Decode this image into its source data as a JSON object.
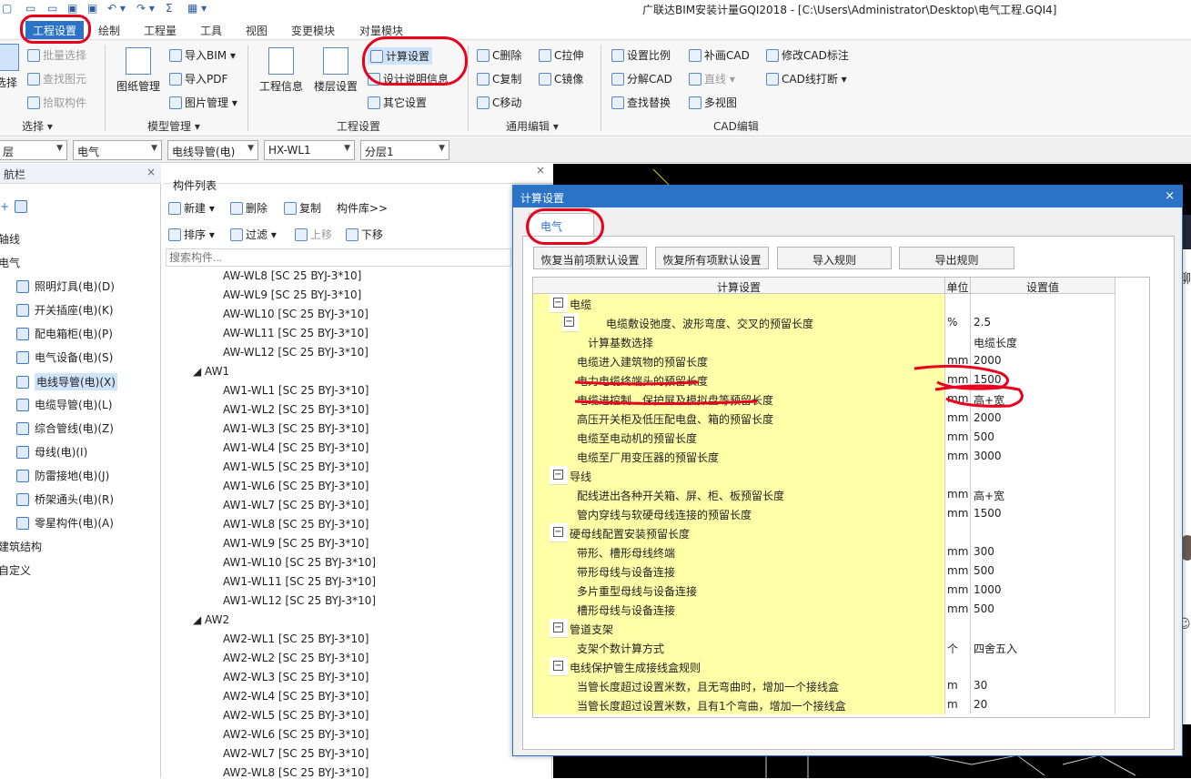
{
  "window": {
    "title": "广联达BIM安装计量GQI2018 - [C:\\Users\\Administrator\\Desktop\\电气工程.GQI4]"
  },
  "menu": {
    "tabs": [
      "工程设置",
      "绘制",
      "工程量",
      "工具",
      "视图",
      "变更模块",
      "对量模块"
    ]
  },
  "ribbon": {
    "select_group": {
      "big_label": "选择",
      "items": [
        "批量选择",
        "查找图元",
        "拾取构件"
      ],
      "label": "选择 ▾"
    },
    "model_group": {
      "big_label": "图纸管理",
      "items": [
        "导入BIM ▾",
        "导入PDF",
        "图片管理 ▾"
      ],
      "label": "模型管理 ▾"
    },
    "project_group": {
      "big1": "工程信息",
      "big2": "楼层设置",
      "items": [
        "计算设置",
        "设计说明信息",
        "其它设置"
      ],
      "label": "工程设置"
    },
    "edit_group": {
      "items": [
        "C删除",
        "C拉伸",
        "C复制",
        "C镜像",
        "C移动"
      ],
      "label": "通用编辑 ▾"
    },
    "cad_group": {
      "items": [
        "设置比例",
        "补画CAD",
        "修改CAD标注",
        "分解CAD",
        "直线 ▾",
        "CAD线打断 ▾",
        "查找替换",
        "多视图"
      ],
      "label": "CAD编辑"
    }
  },
  "filters": {
    "floor": "层",
    "discipline": "电气",
    "type": "电线导管(电)",
    "component": "HX-WL1",
    "layer": "分层1"
  },
  "nav": {
    "title": "航栏",
    "items": [
      {
        "label": "轴线",
        "level": 0
      },
      {
        "label": "电气",
        "level": 0
      },
      {
        "label": "照明灯具(电)(D)",
        "level": 1
      },
      {
        "label": "开关插座(电)(K)",
        "level": 1
      },
      {
        "label": "配电箱柜(电)(P)",
        "level": 1
      },
      {
        "label": "电气设备(电)(S)",
        "level": 1
      },
      {
        "label": "电线导管(电)(X)",
        "level": 1,
        "selected": true
      },
      {
        "label": "电缆导管(电)(L)",
        "level": 1
      },
      {
        "label": "综合管线(电)(Z)",
        "level": 1
      },
      {
        "label": "母线(电)(I)",
        "level": 1
      },
      {
        "label": "防雷接地(电)(J)",
        "level": 1
      },
      {
        "label": "桥架通头(电)(R)",
        "level": 1
      },
      {
        "label": "零星构件(电)(A)",
        "level": 1
      },
      {
        "label": "建筑结构",
        "level": 0
      },
      {
        "label": "自定义",
        "level": 0
      }
    ]
  },
  "components": {
    "title": "构件列表",
    "toolbar1": [
      "新建 ▾",
      "删除",
      "复制",
      "构件库>>"
    ],
    "toolbar2": [
      "排序 ▾",
      "过滤 ▾",
      "上移",
      "下移"
    ],
    "search_placeholder": "搜索构件...",
    "tree": [
      {
        "label": "AW-WL8 [SC 25 BYJ-3*10]",
        "level": 2
      },
      {
        "label": "AW-WL9 [SC 25 BYJ-3*10]",
        "level": 2
      },
      {
        "label": "AW-WL10 [SC 25 BYJ-3*10]",
        "level": 2
      },
      {
        "label": "AW-WL11 [SC 25 BYJ-3*10]",
        "level": 2
      },
      {
        "label": "AW-WL12 [SC 25 BYJ-3*10]",
        "level": 2
      },
      {
        "label": "◢ AW1",
        "level": 1
      },
      {
        "label": "AW1-WL1 [SC 25 BYJ-3*10]",
        "level": 2
      },
      {
        "label": "AW1-WL2 [SC 25 BYJ-3*10]",
        "level": 2
      },
      {
        "label": "AW1-WL3 [SC 25 BYJ-3*10]",
        "level": 2
      },
      {
        "label": "AW1-WL4 [SC 25 BYJ-3*10]",
        "level": 2
      },
      {
        "label": "AW1-WL5 [SC 25 BYJ-3*10]",
        "level": 2
      },
      {
        "label": "AW1-WL6 [SC 25 BYJ-3*10]",
        "level": 2
      },
      {
        "label": "AW1-WL7 [SC 25 BYJ-3*10]",
        "level": 2
      },
      {
        "label": "AW1-WL8 [SC 25 BYJ-3*10]",
        "level": 2
      },
      {
        "label": "AW1-WL9 [SC 25 BYJ-3*10]",
        "level": 2
      },
      {
        "label": "AW1-WL10 [SC 25 BYJ-3*10]",
        "level": 2
      },
      {
        "label": "AW1-WL11 [SC 25 BYJ-3*10]",
        "level": 2
      },
      {
        "label": "AW1-WL12 [SC 25 BYJ-3*10]",
        "level": 2
      },
      {
        "label": "◢ AW2",
        "level": 1
      },
      {
        "label": "AW2-WL1 [SC 25 BYJ-3*10]",
        "level": 2
      },
      {
        "label": "AW2-WL2 [SC 25 BYJ-3*10]",
        "level": 2
      },
      {
        "label": "AW2-WL3 [SC 25 BYJ-3*10]",
        "level": 2
      },
      {
        "label": "AW2-WL4 [SC 25 BYJ-3*10]",
        "level": 2
      },
      {
        "label": "AW2-WL5 [SC 25 BYJ-3*10]",
        "level": 2
      },
      {
        "label": "AW2-WL6 [SC 25 BYJ-3*10]",
        "level": 2
      },
      {
        "label": "AW2-WL7 [SC 25 BYJ-3*10]",
        "level": 2
      },
      {
        "label": "AW2-WL8 [SC 25 BYJ-3*10]",
        "level": 2
      }
    ]
  },
  "dialog": {
    "title": "计算设置",
    "close": "×",
    "tab": "电气",
    "buttons": [
      "恢复当前项默认设置",
      "恢复所有项默认设置",
      "导入规则",
      "导出规则"
    ],
    "columns": [
      "计算设置",
      "单位",
      "设置值"
    ],
    "rows": [
      {
        "kind": "group",
        "name": "电缆",
        "unit": "",
        "value": ""
      },
      {
        "kind": "subgroup",
        "name": "电缆敷设弛度、波形弯度、交叉的预留长度",
        "unit": "%",
        "value": "2.5"
      },
      {
        "kind": "leaf2",
        "name": "计算基数选择",
        "unit": "",
        "value": "电缆长度"
      },
      {
        "kind": "leaf",
        "name": "电缆进入建筑物的预留长度",
        "unit": "mm",
        "value": "2000"
      },
      {
        "kind": "leaf",
        "name": "电力电缆终端头的预留长度",
        "unit": "mm",
        "value": "1500"
      },
      {
        "kind": "leaf",
        "name": "电缆进控制、保护屏及模拟盘等预留长度",
        "unit": "mm",
        "value": "高+宽"
      },
      {
        "kind": "leaf",
        "name": "高压开关柜及低压配电盘、箱的预留长度",
        "unit": "mm",
        "value": "2000"
      },
      {
        "kind": "leaf",
        "name": "电缆至电动机的预留长度",
        "unit": "mm",
        "value": "500"
      },
      {
        "kind": "leaf",
        "name": "电缆至厂用变压器的预留长度",
        "unit": "mm",
        "value": "3000"
      },
      {
        "kind": "group",
        "name": "导线",
        "unit": "",
        "value": ""
      },
      {
        "kind": "leaf",
        "name": "配线进出各种开关箱、屏、柜、板预留长度",
        "unit": "mm",
        "value": "高+宽"
      },
      {
        "kind": "leaf",
        "name": "管内穿线与软硬母线连接的预留长度",
        "unit": "mm",
        "value": "1500"
      },
      {
        "kind": "group",
        "name": "硬母线配置安装预留长度",
        "unit": "",
        "value": ""
      },
      {
        "kind": "leaf",
        "name": "带形、槽形母线终端",
        "unit": "mm",
        "value": "300"
      },
      {
        "kind": "leaf",
        "name": "带形母线与设备连接",
        "unit": "mm",
        "value": "500"
      },
      {
        "kind": "leaf",
        "name": "多片重型母线与设备连接",
        "unit": "mm",
        "value": "1000"
      },
      {
        "kind": "leaf",
        "name": "槽形母线与设备连接",
        "unit": "mm",
        "value": "500"
      },
      {
        "kind": "group",
        "name": "管道支架",
        "unit": "",
        "value": ""
      },
      {
        "kind": "leaf",
        "name": "支架个数计算方式",
        "unit": "个",
        "value": "四舍五入"
      },
      {
        "kind": "group",
        "name": "电线保护管生成接线盒规则",
        "unit": "",
        "value": ""
      },
      {
        "kind": "leaf",
        "name": "当管长度超过设置米数，且无弯曲时，增加一个接线盒",
        "unit": "m",
        "value": "30"
      },
      {
        "kind": "leaf",
        "name": "当管长度超过设置米数，且有1个弯曲，增加一个接线盒",
        "unit": "m",
        "value": "20"
      }
    ]
  },
  "chat_edge": {
    "label": "聊"
  },
  "colors": {
    "accent": "#2b73c7",
    "grid_yellow": "#ffffa8",
    "annotation_red": "#e8001c"
  }
}
